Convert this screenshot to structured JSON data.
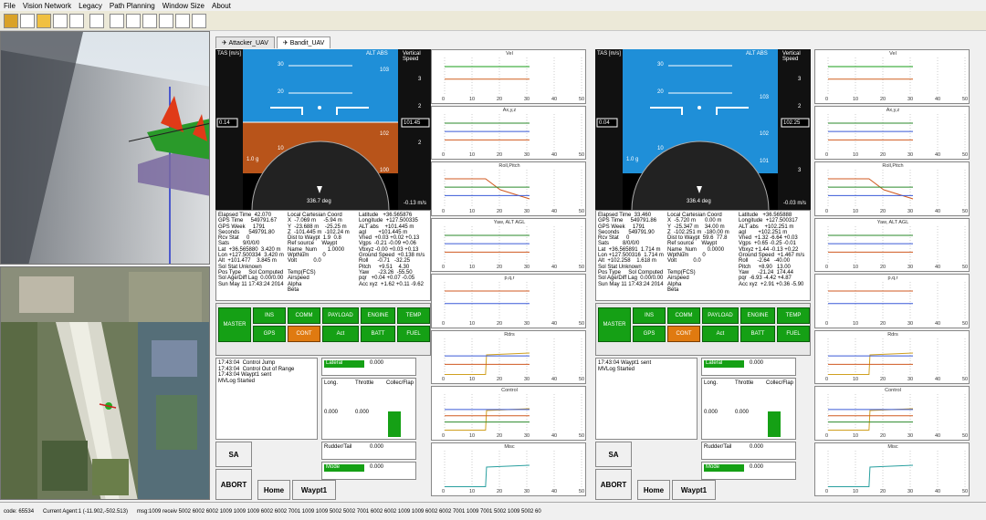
{
  "menu": [
    "File",
    "Vision Network",
    "Legacy",
    "Path Planning",
    "Window Size",
    "About"
  ],
  "tabs": [
    "Attacker_UAV",
    "Bandit_UAV"
  ],
  "hud_left": {
    "tas_label": "TAS [m/s]",
    "alt_label": "ALT ABS",
    "vs_label": "Vertical Speed",
    "speed": "0.14",
    "alt": "101.45",
    "heading": "336.7 deg",
    "gload": "1.0 g",
    "vs_val": "-0.13 m/s",
    "alt_ticks": [
      "103",
      "102",
      "101",
      "100"
    ],
    "pitch_ticks": [
      "30",
      "20",
      "10",
      "10"
    ],
    "vs_ticks": [
      "3",
      "2",
      "1",
      "1",
      "2",
      "3"
    ]
  },
  "hud_right": {
    "tas_label": "TAS [m/s]",
    "alt_label": "ALT ABS",
    "vs_label": "Vertical Speed",
    "speed": "0.04",
    "alt": "102.25",
    "heading": "336.4 deg",
    "gload": "1.0 g",
    "vs_val": "-0.03 m/s",
    "alt_ticks": [
      "103",
      "102",
      "101"
    ],
    "pitch_ticks": [
      "30",
      "20",
      "10",
      "10"
    ],
    "vs_ticks": [
      "3",
      "2",
      "1",
      "1",
      "2",
      "3"
    ]
  },
  "info_left": {
    "c1": "Elapsed Time  42.070\nGPS Time     549791.67\nGPS Week     1791\nSeconds      549791.80\nRcv Stat     0\nSats         9/0/0/0\nLat  +36.565880  3.420 m\nLon +127.500334  3.420 m\nAlt  +101.477    3.845 m\nSol Stat Unknown\nPos Type     Sol Computed\nSol Age/Diff Lag  0.00/0.00\nSun May 11 17:43:24 2014",
    "c2": "Local Cartesian Coord\nX  -7.069 m     -5.94 m\nY  -23.688 m    -25.25 m\nZ  -101.445 m  -102.24 m\nDist to Waypt  1.9  0.8\nRef source     Waypt\nName_Num       1.0000\nWptNum         0\nVolt           0.0\n\nTemp(FCS)\nAirspeed\nAlpha\nBeta",
    "c3": "Latitude   +36.565876\nLongitude  +127.500335\nALT abs    +101.445 m\nagl        +101.445 m\nVned  +0.03 +0.02 +0.13\nVgps  -0.21 -0.09 +0.06\nVbxyz -0.00 +0.03 +0.13\nGround Speed  +0.138 m/s\nRoll      -0.71   -32.25\nPitch     +9.51    4.30\nYaw      -23.26  -55.50\npqr   +0.04 +0.07 -0.05\nAcc xyz  +1.62 +0.11 -9.62"
  },
  "info_right": {
    "c1": "Elapsed Time  33.460\nGPS Time     549791.86\nGPS Week     1791\nSeconds      549791.90\nRcv Stat     0\nSats         8/0/0/0\nLat  +36.565891  1.714 m\nLon +127.500316  1.714 m\nAlt  +102.258    1.618 m\nSol Stat Unknown\nPos Type     Sol Computed\nSol Age/Diff Lag  0.00/0.00\nSun May 11 17:43:24 2014",
    "c2": "Local Cartesian Coord\nX  -5.720 m      0.00 m\nY  -25.347 m    34.00 m\nZ  -102.251 m  -180.00 m\nDist to Waypt  59.6  77.8\nRef source     Waypt\nName_Num       0.0000\nWptNum         0\nVolt           0.0\n\nTemp(FCS)\nAirspeed\nAlpha\nBeta",
    "c3": "Latitude   +36.565888\nLongitude  +127.500317\nALT abs    +102.251 m\nagl        +102.251 m\nVned  +1.32 -6.64 +0.03\nVgps  +0.65 -0.25 -0.01\nVbxyz +1.44 -0.13 +0.22\nGround Speed  +1.467 m/s\nRoll      -2.64   -40.00\nPitch     +8.90   13.00\nYaw      -21.24  174.44\npqr  -6.93 -4.42 +4.87\nAcc xyz  +2.91 +0.36 -5.90"
  },
  "status_btns": {
    "master": "MASTER",
    "ins": "INS",
    "comm": "COMM",
    "payload": "PAYLOAD",
    "engine": "ENGINE",
    "temp": "TEMP",
    "gps": "GPS",
    "cont": "CONT",
    "act": "Act",
    "batt": "BATT",
    "fuel": "FUEL"
  },
  "log_left": "17:43:04  Control Jump\n17:43:04  Control Out of Range\n17:43:04 Waypt1 sent\nMVLog Started",
  "log_right": "17:43:04 Waypt1 sent\nMVLog Started",
  "ctrl": {
    "lateral": "Lateral",
    "long": "Long.",
    "throttle": "Throttle",
    "collec": "Collec/Flap",
    "rudder": "Rudder/Tail",
    "mode": "Mode",
    "val": "0.000"
  },
  "buttons": {
    "sa": "SA",
    "abort": "ABORT",
    "home": "Home",
    "waypt": "Waypt1"
  },
  "plot_titles": [
    "Vel",
    "Ax,y,z",
    "Roll,Pitch",
    "Yaw, ALT AGL",
    "p,q,r",
    "Rdrs",
    "Control",
    "Misc"
  ],
  "plot_titles_right": [
    "Vel",
    "Ax,y,z",
    "Roll,Pitch",
    "Yaw, ALT AGL",
    "p,q,r",
    "Rdrs",
    "Control",
    "Misc"
  ],
  "xticks": [
    "0",
    "10",
    "20",
    "30",
    "40",
    "50"
  ],
  "status": {
    "code": "code: 65534",
    "agent": "Current Agent:1   (-11.902,-502.513)",
    "msg": "msg:1009 receiv  5002 6002 6002 1009 1009 1009 6002 6002 7001 1009 1009 5002 5002 7001 6002 6002 1009 1009 6002 6002 7001 1009 7001 5002 1009 5002 60"
  }
}
